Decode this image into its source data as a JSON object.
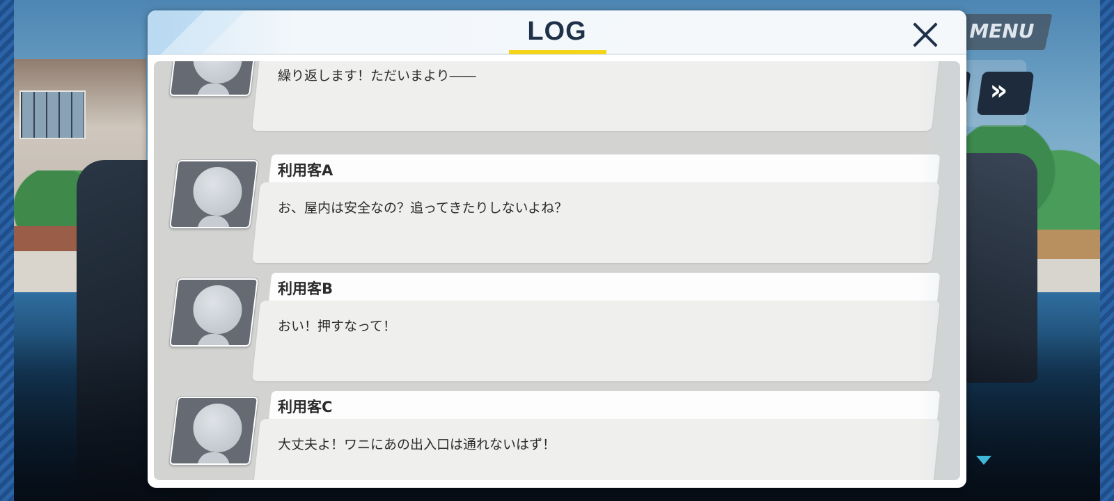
{
  "hud": {
    "menu_label": "MENU",
    "fast_forward_glyph": "»",
    "fast_forward_icon": "fast-forward-icon",
    "next_indicator_icon": "triangle-down-icon"
  },
  "log": {
    "title": "LOG",
    "close_icon": "close-icon",
    "accent_color": "#f5d51a",
    "entries": [
      {
        "speaker": "",
        "text": "繰り返します！ただいまより――"
      },
      {
        "speaker": "利用客A",
        "text": "お、屋内は安全なの？追ってきたりしないよね？"
      },
      {
        "speaker": "利用客B",
        "text": "おい！押すなって！"
      },
      {
        "speaker": "利用客C",
        "text": "大丈夫よ！ワニにあの出入口は通れないはず！"
      }
    ]
  }
}
